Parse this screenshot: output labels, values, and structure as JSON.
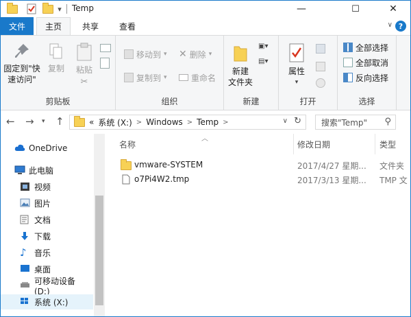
{
  "window": {
    "title": "Temp",
    "minimize": "—",
    "maximize": "☐",
    "close": "✕"
  },
  "quick_access": {
    "dropdown": "▾"
  },
  "tabs": {
    "file": "文件",
    "home": "主页",
    "share": "共享",
    "view": "查看",
    "collapse": "∨",
    "help": "?"
  },
  "ribbon": {
    "clipboard": {
      "label": "剪贴板",
      "pin": "固定到\"快速访问\"",
      "copy": "复制",
      "paste": "粘贴"
    },
    "organize": {
      "label": "组织",
      "move_to": "移动到",
      "copy_to": "复制到",
      "delete": "删除",
      "rename": "重命名"
    },
    "new": {
      "label": "新建",
      "new_folder": "新建\n文件夹"
    },
    "open": {
      "label": "打开",
      "properties": "属性"
    },
    "select": {
      "label": "选择",
      "select_all": "全部选择",
      "select_none": "全部取消",
      "invert": "反向选择"
    }
  },
  "address": {
    "overflow": "«",
    "crumbs": [
      "系统 (X:)",
      "Windows",
      "Temp"
    ],
    "sep": ">",
    "search_placeholder": "搜索\"Temp\""
  },
  "sidebar": {
    "items": [
      {
        "label": "OneDrive",
        "icon": "cloud-icon"
      },
      {
        "label": "此电脑",
        "icon": "computer-icon"
      },
      {
        "label": "视频",
        "icon": "video-icon"
      },
      {
        "label": "图片",
        "icon": "picture-icon"
      },
      {
        "label": "文档",
        "icon": "document-icon"
      },
      {
        "label": "下载",
        "icon": "download-icon"
      },
      {
        "label": "音乐",
        "icon": "music-icon"
      },
      {
        "label": "桌面",
        "icon": "desktop-icon"
      },
      {
        "label": "可移动设备 (D:)",
        "icon": "usb-drive-icon"
      },
      {
        "label": "系统 (X:)",
        "icon": "windows-drive-icon"
      }
    ]
  },
  "filelist": {
    "columns": {
      "name": "名称",
      "modified": "修改日期",
      "type": "类型"
    },
    "rows": [
      {
        "name": "vmware-SYSTEM",
        "modified": "2017/4/27 星期...",
        "type": "文件夹",
        "kind": "folder"
      },
      {
        "name": "o7Pi4W2.tmp",
        "modified": "2017/3/13 星期...",
        "type": "TMP 文",
        "kind": "file"
      }
    ]
  },
  "colors": {
    "accent": "#1979ca",
    "folder": "#f7d155"
  }
}
